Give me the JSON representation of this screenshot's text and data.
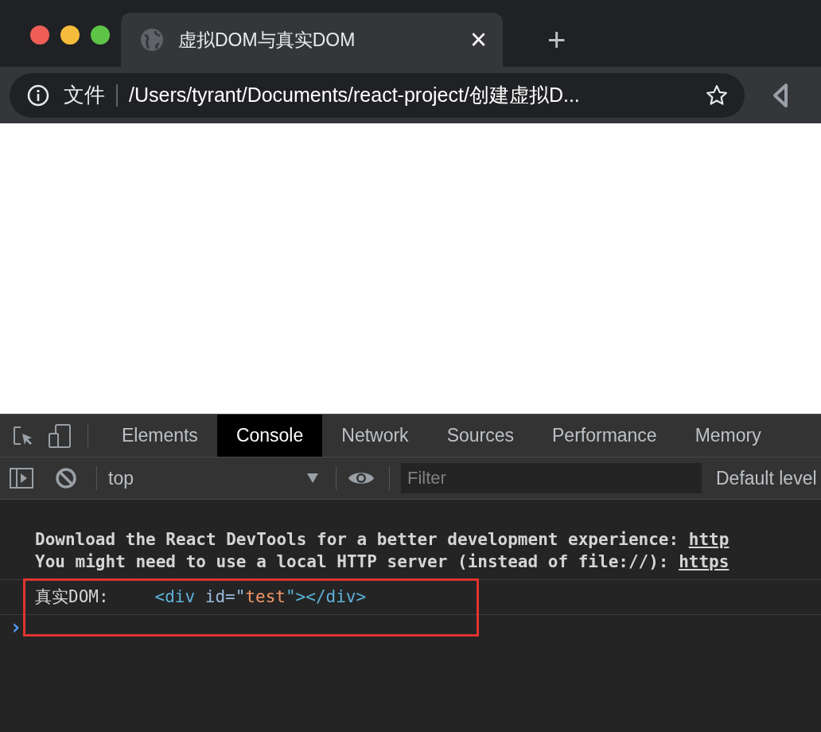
{
  "browser": {
    "tab": {
      "title": "虚拟DOM与真实DOM",
      "close": "×"
    },
    "new_tab": "+",
    "address": {
      "scheme_label": "文件",
      "url": "/Users/tyrant/Documents/react-project/创建虚拟D..."
    }
  },
  "devtools": {
    "tabs": [
      {
        "label": "Elements",
        "selected": false
      },
      {
        "label": "Console",
        "selected": true
      },
      {
        "label": "Network",
        "selected": false
      },
      {
        "label": "Sources",
        "selected": false
      },
      {
        "label": "Performance",
        "selected": false
      },
      {
        "label": "Memory",
        "selected": false
      }
    ],
    "toolbar": {
      "context": "top",
      "filter_placeholder": "Filter",
      "levels": "Default level"
    },
    "messages": [
      {
        "text": "Download the React DevTools for a better development experience: ",
        "link": "http"
      },
      {
        "text": "You might need to use a local HTTP server (instead of file://): ",
        "link": "https"
      }
    ],
    "log": {
      "label": "真实DOM:",
      "tokens": [
        {
          "kind": "tag",
          "text": "<div "
        },
        {
          "kind": "attr",
          "text": "id=\""
        },
        {
          "kind": "value",
          "text": "test"
        },
        {
          "kind": "tag",
          "text": "\"></div>"
        }
      ]
    },
    "prompt": "›"
  }
}
